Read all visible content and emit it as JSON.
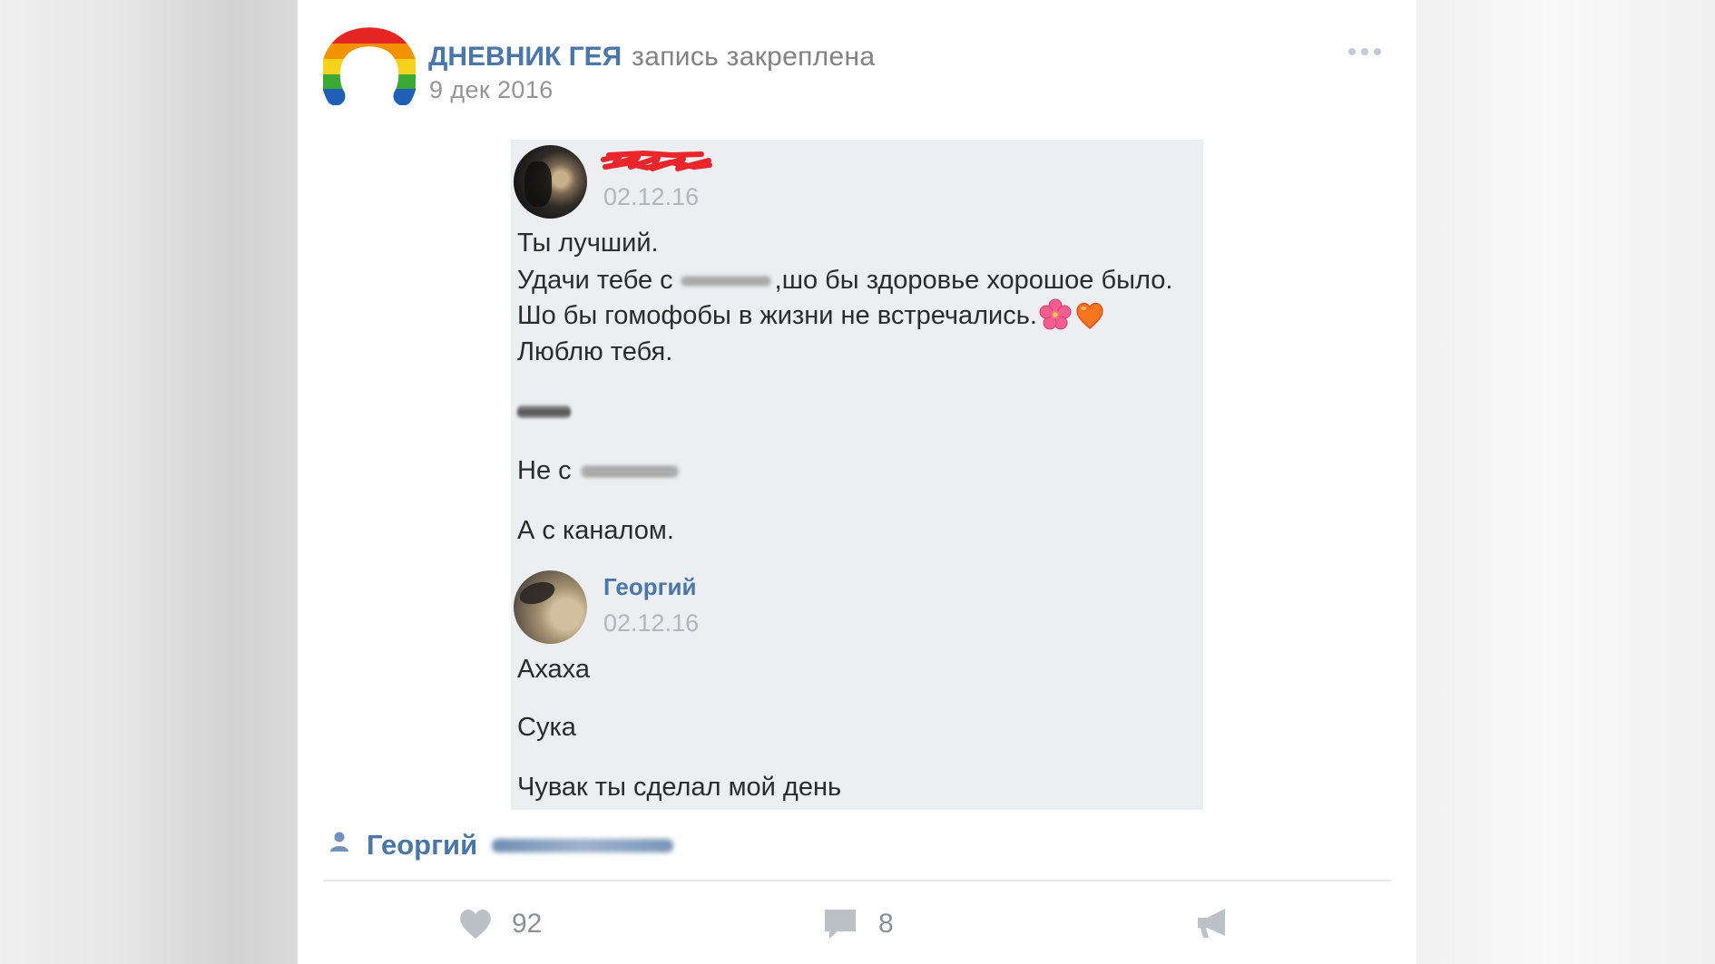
{
  "post": {
    "logo_icon": "rainbow-arch-logo",
    "community_name": "ДНЕВНИК ГЕЯ",
    "pinned_label": "запись закреплена",
    "date": "9 дек 2016",
    "more_icon": "more-dots-icon"
  },
  "attached_screenshot": {
    "messages": [
      {
        "author_redacted": true,
        "avatar_icon": "user-avatar-photo",
        "date": "02.12.16",
        "lines": [
          {
            "text": "Ты лучший."
          },
          {
            "text": "Удачи тебе с",
            "redacted_word": true,
            "text_after": ",шо бы здоровье хорошое было."
          },
          {
            "text": "Шо бы гомофобы в жизни не встречались.",
            "emoji": [
              "hibiscus-icon",
              "orange-heart-icon"
            ]
          },
          {
            "text": "Люблю тебя."
          },
          {
            "redacted_signature": true
          },
          {
            "text": "Не с",
            "redacted_word": true
          },
          {
            "text": "А с каналом."
          }
        ]
      },
      {
        "author": "Георгий",
        "avatar_icon": "user-avatar-photo",
        "date": "02.12.16",
        "lines": [
          {
            "text": "Ахаха"
          },
          {
            "text": "Сука"
          },
          {
            "text": "Чувак ты сделал мой день"
          }
        ]
      }
    ]
  },
  "signature": {
    "icon": "person-icon",
    "name": "Георгий",
    "surname_redacted": true
  },
  "actions": {
    "like": {
      "icon": "heart-icon",
      "count": "92"
    },
    "comment": {
      "icon": "comment-icon",
      "count": "8"
    },
    "share": {
      "icon": "megaphone-icon"
    }
  },
  "colors": {
    "link_blue": "#4a76a8",
    "muted_gray": "#828282",
    "panel_bg": "#edeef1",
    "icon_gray": "#bcc1c8",
    "redaction_red": "#e8262b"
  }
}
